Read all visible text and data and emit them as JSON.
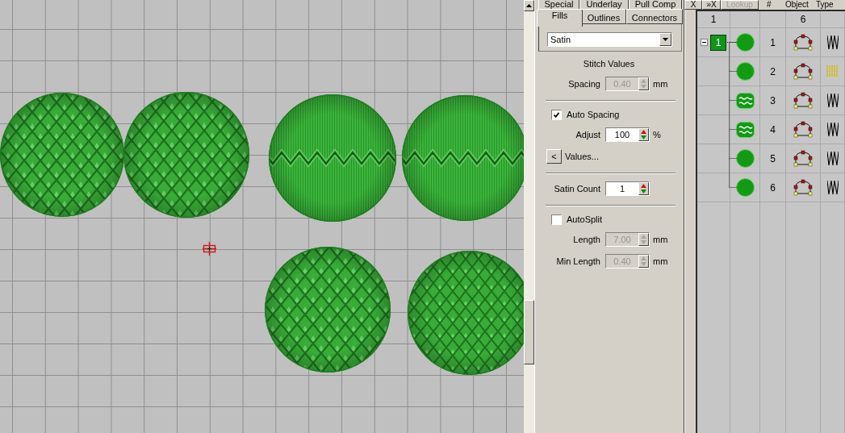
{
  "tab_rows": [
    {
      "tabs": [
        {
          "label": "Special",
          "selected": false
        },
        {
          "label": "Underlay",
          "selected": false
        },
        {
          "label": "Pull Comp",
          "selected": false
        }
      ]
    },
    {
      "tabs": [
        {
          "label": "Fills",
          "selected": true
        },
        {
          "label": "Outlines",
          "selected": false
        },
        {
          "label": "Connectors",
          "selected": false
        }
      ]
    }
  ],
  "fill_type": {
    "value": "Satin"
  },
  "sections": [
    {
      "items": [
        {
          "kind": "heading",
          "text": "Stitch Values"
        },
        {
          "kind": "field",
          "label": "Spacing",
          "value": "0.40",
          "unit": "mm",
          "disabled": true
        }
      ]
    },
    {
      "items": [
        {
          "kind": "checkbox",
          "label": "Auto Spacing",
          "checked": true
        },
        {
          "kind": "field",
          "label": "Adjust",
          "value": "100",
          "unit": "%",
          "disabled": false
        },
        {
          "kind": "button",
          "text": "<",
          "label": "Values..."
        }
      ]
    },
    {
      "items": [
        {
          "kind": "field",
          "label": "Satin Count",
          "value": "1",
          "disabled": false
        }
      ]
    },
    {
      "items": [
        {
          "kind": "checkbox",
          "label": "AutoSplit",
          "checked": false
        },
        {
          "kind": "field",
          "label": "Length",
          "value": "7.00",
          "unit": "mm",
          "disabled": true
        },
        {
          "kind": "field",
          "label": "Min Length",
          "value": "0.40",
          "unit": "mm",
          "disabled": true
        }
      ]
    }
  ],
  "object_list": {
    "toolbar": [
      {
        "label": "X",
        "disabled": false
      },
      {
        "label": "»X",
        "disabled": false
      },
      {
        "label": "Lookup",
        "disabled": true
      }
    ],
    "columns": [
      {
        "label": "#"
      },
      {
        "label": "Object"
      },
      {
        "label": "Type"
      }
    ],
    "header": {
      "column_1": "1",
      "column_4": "6"
    },
    "group": {
      "label": "1",
      "expanded": true,
      "children": [
        {
          "number": "1",
          "object": {
            "kind": "circle"
          },
          "type": {
            "kind": "zigzag"
          }
        },
        {
          "number": "2",
          "object": {
            "kind": "circle"
          },
          "type": {
            "kind": "fill"
          }
        },
        {
          "number": "3",
          "object": {
            "kind": "band"
          },
          "type": {
            "kind": "zigzag"
          }
        },
        {
          "number": "4",
          "object": {
            "kind": "band"
          },
          "type": {
            "kind": "zigzag"
          }
        },
        {
          "number": "5",
          "object": {
            "kind": "circle"
          },
          "type": {
            "kind": "zigzag"
          }
        },
        {
          "number": "6",
          "object": {
            "kind": "circle"
          },
          "type": {
            "kind": "zigzag"
          }
        }
      ]
    }
  }
}
